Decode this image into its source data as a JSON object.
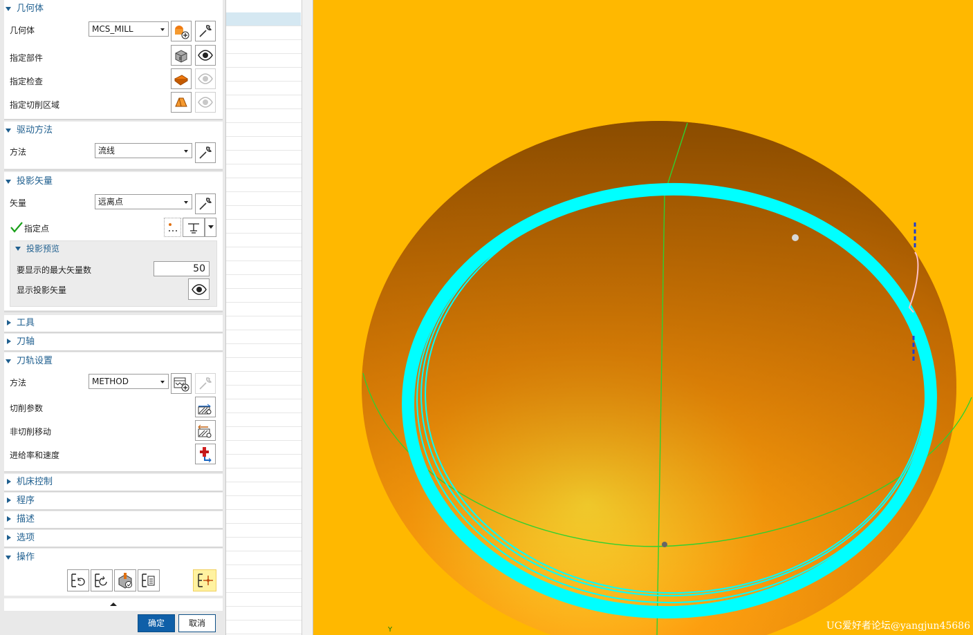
{
  "geometry_group": {
    "title": "几何体",
    "geometry_label": "几何体",
    "geometry_value": "MCS_MILL",
    "specify_part": "指定部件",
    "specify_check": "指定检查",
    "specify_cut_area": "指定切削区域"
  },
  "drive_method": {
    "title": "驱动方法",
    "method_label": "方法",
    "method_value": "流线"
  },
  "projection_vector": {
    "title": "投影矢量",
    "vector_label": "矢量",
    "vector_value": "远离点",
    "specify_point": "指定点",
    "preview": {
      "title": "投影预览",
      "max_vectors_label": "要显示的最大矢量数",
      "max_vectors_value": "50",
      "show_vectors_label": "显示投影矢量"
    }
  },
  "collapsed_top": {
    "tool": "工具",
    "axis": "刀轴"
  },
  "path_settings": {
    "title": "刀轨设置",
    "method_label": "方法",
    "method_value": "METHOD",
    "cut_params": "切削参数",
    "non_cut_moves": "非切削移动",
    "feeds_speeds": "进给率和速度"
  },
  "collapsed_bottom": {
    "machine_control": "机床控制",
    "program": "程序",
    "description": "描述",
    "options": "选项"
  },
  "actions": {
    "title": "操作"
  },
  "footer": {
    "ok": "确定",
    "cancel": "取消"
  },
  "viewport": {
    "watermark": "UG爱好者论坛@yangjun45686",
    "axis_label": "Y",
    "colors": {
      "background": "#ffb800",
      "toolpath": "#00ffff",
      "guide": "#30d030",
      "surface": "#f29a10"
    }
  }
}
